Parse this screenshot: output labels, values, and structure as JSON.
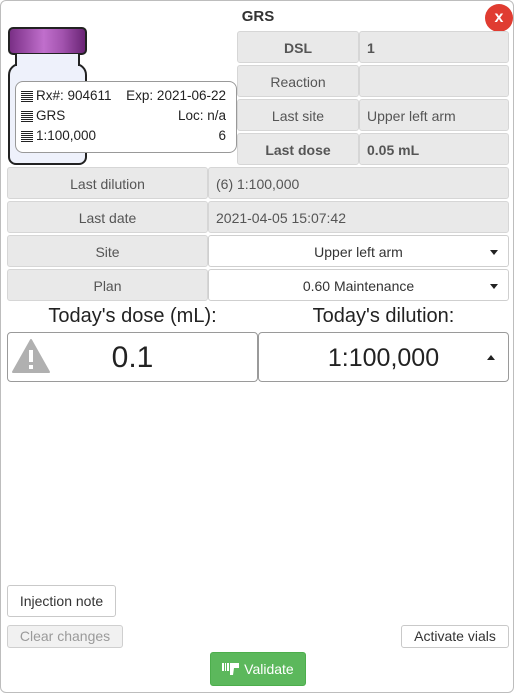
{
  "header": {
    "title": "GRS",
    "close_label": "x"
  },
  "vial": {
    "rx_label": "Rx#: 904611",
    "exp_label": "Exp: 2021-06-22",
    "name": "GRS",
    "loc_label": "Loc: n/a",
    "dilution": "1:100,000",
    "dilution_number": "6",
    "cap_color": "#9b3fa8"
  },
  "info": {
    "dsl": {
      "label": "DSL",
      "value": "1"
    },
    "reaction": {
      "label": "Reaction",
      "value": ""
    },
    "last_site": {
      "label": "Last site",
      "value": "Upper left arm"
    },
    "last_dose": {
      "label": "Last dose",
      "value": "0.05 mL"
    },
    "last_dilution": {
      "label": "Last dilution",
      "value": "(6) 1:100,000"
    },
    "last_date": {
      "label": "Last date",
      "value": "2021-04-05 15:07:42"
    }
  },
  "form": {
    "site": {
      "label": "Site",
      "value": "Upper left arm"
    },
    "plan": {
      "label": "Plan",
      "value": "0.60 Maintenance"
    }
  },
  "today": {
    "dose_label": "Today's dose (mL):",
    "dose_value": "0.1",
    "dilution_label": "Today's dilution:",
    "dilution_value": "1:100,000"
  },
  "buttons": {
    "injection_note": "Injection note",
    "clear_changes": "Clear changes",
    "activate_vials": "Activate vials",
    "validate": "Validate"
  },
  "colors": {
    "close_red": "#e03c31",
    "validate_green": "#5cb85c",
    "warning_grey": "#b0b0b0"
  },
  "icons": [
    "close-icon",
    "barcode-icon",
    "warning-icon",
    "caret-down-icon",
    "caret-up-icon",
    "scanner-gun-icon"
  ]
}
